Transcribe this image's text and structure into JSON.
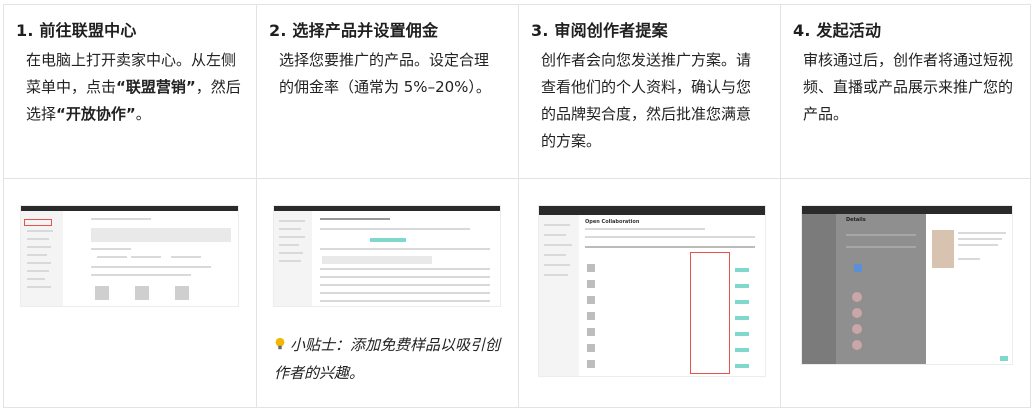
{
  "steps": [
    {
      "title": "1. 前往联盟中心",
      "desc_parts": [
        "在电脑上打开卖家中心。从左侧菜单中，点击",
        "“联盟营销”",
        "，然后选择",
        "“开放协作”",
        "。"
      ]
    },
    {
      "title": "2. 选择产品并设置佣金",
      "desc": "选择您要推广的产品。设定合理的佣金率（通常为 5%–20%）。",
      "tip": "小贴士：添加免费样品以吸引创作者的兴趣。"
    },
    {
      "title": "3. 审阅创作者提案",
      "desc": "创作者会向您发送推广方案。请查看他们的个人资料，确认与您的品牌契合度，然后批准您满意的方案。"
    },
    {
      "title": "4. 发起活动",
      "desc": "审核通过后，创作者将通过短视频、直播或产品展示来推广您的产品。"
    }
  ],
  "screenshots": {
    "shot3_title": "Open Collaboration",
    "shot4_title": "Details"
  },
  "colors": {
    "border": "#e3e3e3",
    "highlight_red": "#e5534b",
    "status_teal": "#7fd8cc",
    "tip_bulb": "#f2b705"
  },
  "icons": [
    "lightbulb-icon"
  ]
}
